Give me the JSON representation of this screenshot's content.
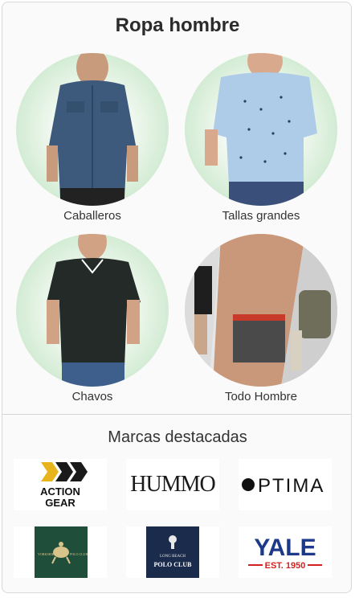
{
  "title": "Ropa hombre",
  "categories": [
    {
      "label": "Caballeros"
    },
    {
      "label": "Tallas grandes"
    },
    {
      "label": "Chavos"
    },
    {
      "label": "Todo Hombre"
    }
  ],
  "brands_title": "Marcas destacadas",
  "brands": [
    {
      "name": "ACTION GEAR",
      "line1": "ACTION",
      "line2": "GEAR"
    },
    {
      "name": "HUMMO"
    },
    {
      "name": "OPTIMA",
      "text": "PTIMA"
    },
    {
      "name": "YORKSHIRE POLO CLUB",
      "left": "YORKSHIRE",
      "right": "POLO CLUB"
    },
    {
      "name": "LONG BEACH POLO CLUB",
      "line1": "LONG BEACH",
      "line2": "POLO CLUB"
    },
    {
      "name": "YALE",
      "text": "YALE",
      "sub": "EST. 1950"
    }
  ],
  "colors": {
    "yale_blue": "#1d3a8a",
    "yale_red": "#d32020",
    "polo_green": "#1f4f3a",
    "polo_navy": "#1a2b4c",
    "action_yellow": "#e8b41c"
  }
}
